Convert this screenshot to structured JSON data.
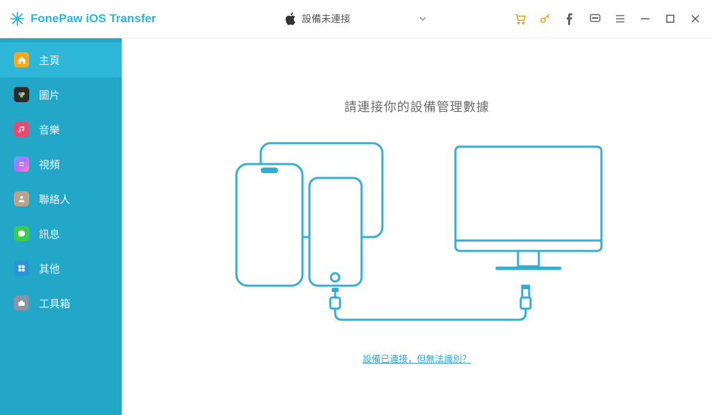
{
  "app_title": "FonePaw iOS Transfer",
  "device_status": "設備未連接",
  "sidebar": {
    "items": [
      {
        "label": "主頁"
      },
      {
        "label": "圖片"
      },
      {
        "label": "音樂"
      },
      {
        "label": "視頻"
      },
      {
        "label": "聯絡人"
      },
      {
        "label": "訊息"
      },
      {
        "label": "其他"
      },
      {
        "label": "工具箱"
      }
    ]
  },
  "main": {
    "prompt": "請連接你的設備管理數據",
    "help_link": "設備已連接，但無法識別？"
  },
  "colors": {
    "accent": "#23a7c9",
    "link": "#2aa9cc",
    "toolbar_accent": "#f39c12"
  }
}
